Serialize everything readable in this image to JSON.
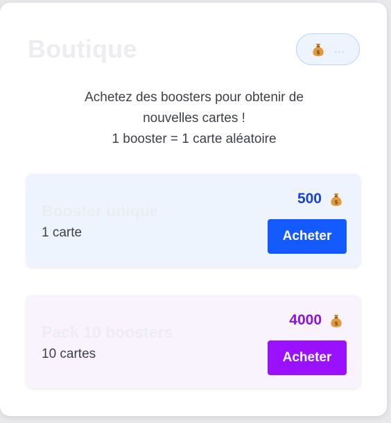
{
  "shop": {
    "title": "Boutique",
    "balance": "...",
    "intro_line1": "Achetez des boosters pour obtenir de nouvelles cartes !",
    "intro_line2": "1 booster = 1 carte aléatoire"
  },
  "offers": [
    {
      "name": "Booster unique",
      "count": "1 carte",
      "price": "500",
      "buy_label": "Acheter",
      "accent": "#145bff"
    },
    {
      "name": "Pack 10 boosters",
      "count": "10 cartes",
      "price": "4000",
      "buy_label": "Acheter",
      "accent": "#9911ff"
    }
  ],
  "icons": {
    "currency": "money-bag-icon"
  }
}
